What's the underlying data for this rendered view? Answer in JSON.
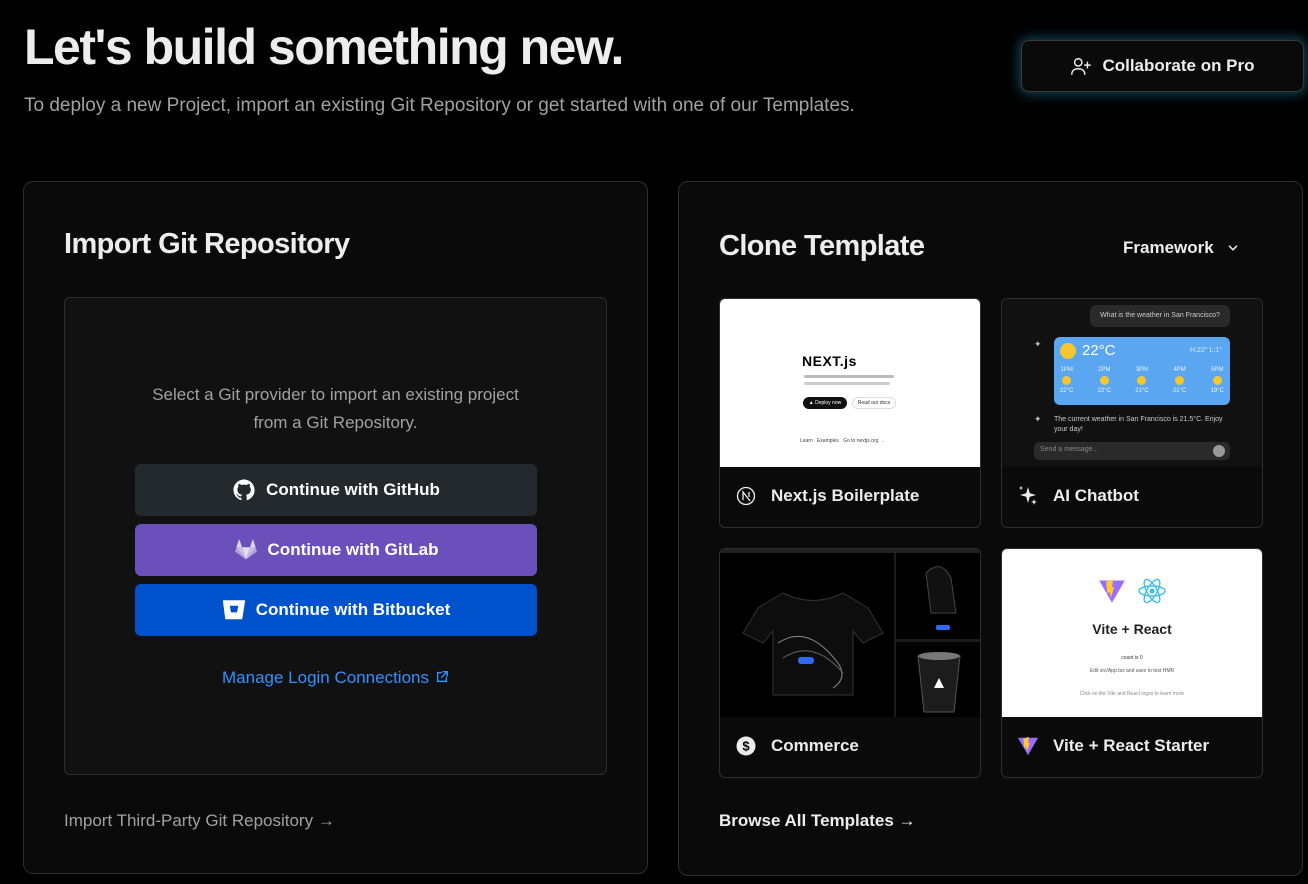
{
  "header": {
    "title": "Let's build something new.",
    "subtitle": "To deploy a new Project, import an existing Git Repository or get started with one of our Templates.",
    "collaborate_label": "Collaborate on Pro"
  },
  "import_panel": {
    "title": "Import Git Repository",
    "description_line1": "Select a Git provider to import an existing project",
    "description_line2": "from a Git Repository.",
    "providers": [
      {
        "label": "Continue with GitHub",
        "icon": "github-icon",
        "color": "#24292e"
      },
      {
        "label": "Continue with GitLab",
        "icon": "gitlab-icon",
        "color": "#6b4fbb"
      },
      {
        "label": "Continue with Bitbucket",
        "icon": "bitbucket-icon",
        "color": "#0052cc"
      }
    ],
    "manage_link": "Manage Login Connections",
    "third_party_link": "Import Third-Party Git Repository →"
  },
  "clone_panel": {
    "title": "Clone Template",
    "framework_label": "Framework",
    "templates": [
      {
        "name": "Next.js Boilerplate",
        "icon": "nextjs-icon"
      },
      {
        "name": "AI Chatbot",
        "icon": "sparkles-icon"
      },
      {
        "name": "Commerce",
        "icon": "dollar-icon"
      },
      {
        "name": "Vite + React Starter",
        "icon": "vite-icon"
      }
    ],
    "browse_link": "Browse All Templates →"
  },
  "previews": {
    "nextjs": {
      "logo": "NEXT.js",
      "btn1": "▲ Deploy now",
      "btn2": "Read our docs",
      "footer": "Learn   Examples   Go to nextjs.org →"
    },
    "chatbot": {
      "question": "What is the weather in San Francisco?",
      "temp": "22°C",
      "hilo": "H:22° L:1°",
      "hours": [
        "1PM",
        "2PM",
        "3PM",
        "4PM",
        "5PM"
      ],
      "hour_temps": [
        "22°C",
        "22°C",
        "21°C",
        "21°C",
        "19°C"
      ],
      "answer": "The current weather in San Francisco is 21.5°C. Enjoy your day!",
      "placeholder": "Send a message..."
    },
    "vite": {
      "title": "Vite + React",
      "counter": "count is 0",
      "edit_hint": "Edit src/App.tsx and save to test HMR",
      "docs_hint": "Click on the Vite and React logos to learn more"
    }
  },
  "colors": {
    "accent_link": "#3291ff",
    "weather_card": "#5aa6f0",
    "sun": "#f7c62f"
  }
}
